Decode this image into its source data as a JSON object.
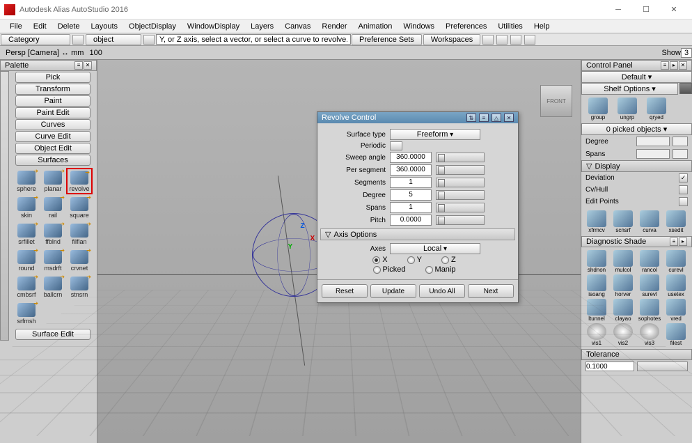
{
  "titlebar": {
    "app_title": "Autodesk Alias AutoStudio 2016"
  },
  "menubar": [
    "File",
    "Edit",
    "Delete",
    "Layouts",
    "ObjectDisplay",
    "WindowDisplay",
    "Layers",
    "Canvas",
    "Render",
    "Animation",
    "Windows",
    "Preferences",
    "Utilities",
    "Help"
  ],
  "toolbar": {
    "category_label": "Category",
    "object_label": "object",
    "hint_text": "Y, or Z axis, select a vector, or select a curve to revolve.",
    "preference_sets": "Preference Sets",
    "workspaces": "Workspaces"
  },
  "toolbar2": {
    "camera_label": "Persp [Camera] ↔ mm",
    "zoom_value": "100",
    "show_label": "Show",
    "frame_value": "3"
  },
  "palette": {
    "header": "Palette",
    "categories": [
      "Pick",
      "Transform",
      "Paint",
      "Paint Edit",
      "Curves",
      "Curve Edit",
      "Object Edit",
      "Surfaces",
      "Surface Edit"
    ],
    "expanded_category": "Surfaces",
    "tools": [
      {
        "label": "sphere"
      },
      {
        "label": "planar"
      },
      {
        "label": "revolve",
        "selected": true
      },
      {
        "label": "skin"
      },
      {
        "label": "rail"
      },
      {
        "label": "square"
      },
      {
        "label": "srfillet"
      },
      {
        "label": "ffblnd"
      },
      {
        "label": "filflan"
      },
      {
        "label": "round"
      },
      {
        "label": "msdrft"
      },
      {
        "label": "crvnet"
      },
      {
        "label": "cmbsrf"
      },
      {
        "label": "ballcrn"
      },
      {
        "label": "stnsrn"
      },
      {
        "label": "srfmsh"
      }
    ]
  },
  "control_panel": {
    "header": "Control Panel",
    "default_label": "Default",
    "shelf_options_label": "Shelf Options",
    "picked_label": "0 picked objects",
    "degree_label": "Degree",
    "spans_label": "Spans",
    "display_label": "Display",
    "deviation_label": "Deviation",
    "deviation_checked": true,
    "cvhull_label": "Cv/Hull",
    "editpoints_label": "Edit Points",
    "shelf1": [
      {
        "label": "group"
      },
      {
        "label": "ungrp"
      },
      {
        "label": "qryed"
      }
    ],
    "shelf2": [
      {
        "label": "xfrmcv"
      },
      {
        "label": "scnsrf"
      },
      {
        "label": "curva"
      },
      {
        "label": "xsedit"
      }
    ]
  },
  "diag_shade": {
    "header": "Diagnostic Shade",
    "tools": [
      {
        "label": "shdnon"
      },
      {
        "label": "mulcol"
      },
      {
        "label": "rancol"
      },
      {
        "label": "curevl"
      },
      {
        "label": "isoang"
      },
      {
        "label": "horver"
      },
      {
        "label": "surevl"
      },
      {
        "label": "usetex"
      },
      {
        "label": "ltunnel"
      },
      {
        "label": "clayao"
      },
      {
        "label": "sophotes"
      },
      {
        "label": "vred"
      },
      {
        "label": "vis1"
      },
      {
        "label": "vis2"
      },
      {
        "label": "vis3"
      },
      {
        "label": "filest"
      }
    ],
    "tolerance_label": "Tolerance",
    "tolerance_value": "0.1000"
  },
  "dialog": {
    "title": "Revolve Control",
    "surface_type_label": "Surface type",
    "surface_type_value": "Freeform",
    "periodic_label": "Periodic",
    "sweep_angle_label": "Sweep angle",
    "sweep_angle_value": "360.0000",
    "per_segment_label": "Per segment",
    "per_segment_value": "360.0000",
    "segments_label": "Segments",
    "segments_value": "1",
    "degree_label": "Degree",
    "degree_value": "5",
    "spans_label": "Spans",
    "spans_value": "1",
    "pitch_label": "Pitch",
    "pitch_value": "0.0000",
    "axis_options_label": "Axis Options",
    "axes_label": "Axes",
    "axes_value": "Local",
    "axis_x": "X",
    "axis_y": "Y",
    "axis_z": "Z",
    "axis_picked": "Picked",
    "axis_manip": "Manip",
    "btn_reset": "Reset",
    "btn_update": "Update",
    "btn_undo": "Undo All",
    "btn_next": "Next"
  },
  "viewport": {
    "cube_face": "FRONT"
  }
}
